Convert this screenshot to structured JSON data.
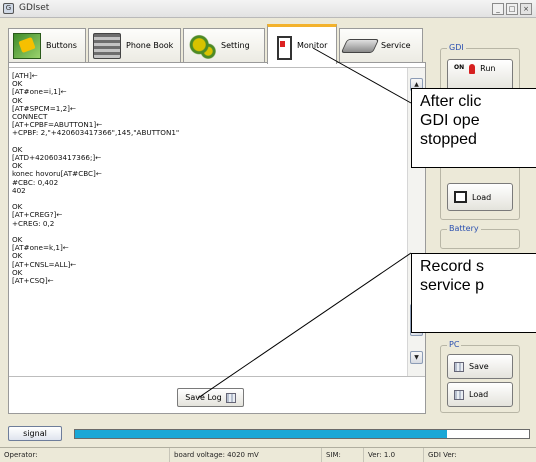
{
  "window": {
    "title": "GDIset",
    "app_icon": "gdi-app-icon"
  },
  "tabs": [
    {
      "label": "Buttons",
      "icon": "buttons-icon",
      "active": false
    },
    {
      "label": "Phone Book",
      "icon": "phone-book-icon",
      "active": false
    },
    {
      "label": "Setting",
      "icon": "setting-icon",
      "active": false
    },
    {
      "label": "Monitor",
      "icon": "monitor-icon",
      "active": true
    },
    {
      "label": "Service",
      "icon": "service-icon",
      "active": false
    }
  ],
  "monitor": {
    "log": [
      "[ATH]←",
      "OK",
      "[AT#one=i,1]←",
      "OK",
      "[AT#SPCM=1,2]←",
      "CONNECT",
      "[AT+CPBF=ABUTTON1]←",
      "+CPBF: 2,\"+420603417366\",145,\"ABUTTON1\"",
      "",
      "OK",
      "[ATD+420603417366;]←",
      "OK",
      "konec hovoru[AT#CBC]←",
      "#CBC: 0,402",
      "402",
      "",
      "OK",
      "[AT+CREG?]←",
      "+CREG: 0,2",
      "",
      "OK",
      "[AT#one=k,1]←",
      "OK",
      "[AT+CNSL=ALL]←",
      "OK",
      "[AT+CSQ]←"
    ],
    "save_log_label": "Save Log"
  },
  "gdi_group": {
    "title": "GDI",
    "run_label": "Run",
    "on_tag": "ON",
    "load_label": "Load"
  },
  "battery_group": {
    "title": "Battery"
  },
  "pc_group": {
    "title": "PC",
    "save_label": "Save",
    "load_label": "Load"
  },
  "callouts": [
    {
      "line1": "After clic",
      "line2": "GDI ope",
      "line3": "stopped"
    },
    {
      "line1": "Record s",
      "line2": "service p"
    }
  ],
  "signal": {
    "label": "signal",
    "level": 0.82,
    "color": "#1aa7d6"
  },
  "statusbar": {
    "operator": "Operator:",
    "board_voltage": "board voltage: 4020 mV",
    "sim": "SIM:",
    "ver": "Ver: 1.0",
    "gdi_ver": "GDI Ver:"
  }
}
